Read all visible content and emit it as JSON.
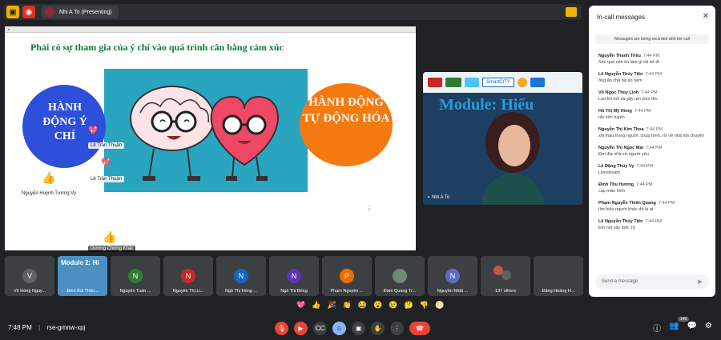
{
  "top_bar": {
    "presenter_label": "Nhi A To (Presenting)"
  },
  "slide": {
    "title": "Phải có sự tham gia của ý chí vào quá trình cân bằng cảm xúc",
    "left_circle_text": "HÀNH ĐỘNG Ý CHÍ",
    "right_circle_text": "HÀNH ĐỘNG TỰ ĐỘNG HÓA",
    "labels": {
      "le_tran_thuan_1": "Lê Trần Thuận",
      "le_tran_thuan_2": "Lê Trần Thuận",
      "nguyen_huynh_tuong_vy": "Nguyễn Huỳnh Tường Vy",
      "duong_chung_khai": "Dương Chừng Khải"
    }
  },
  "presenter_video": {
    "title_text": "Module: Hiểu",
    "name": "Nhi A To",
    "logos": [
      "SmartCITY"
    ]
  },
  "participants": [
    {
      "initial": "V",
      "name": "Võ Hồng Nguy...",
      "color": "#5f6368"
    },
    {
      "initial": "",
      "name": "Đinh Bùi Thảo...",
      "color": "#4a90c2"
    },
    {
      "initial": "N",
      "name": "Nguyễn Tuấn ...",
      "color": "#2e7d32"
    },
    {
      "initial": "N",
      "name": "Nguyễn Thị Li...",
      "color": "#c62828"
    },
    {
      "initial": "N",
      "name": "Ngô Thị Hồng ...",
      "color": "#1565c0"
    },
    {
      "initial": "N",
      "name": "Ngô Thị Bông",
      "color": "#5e35b1"
    },
    {
      "initial": "P",
      "name": "Phạm Nguyễn ...",
      "color": "#ef6c00"
    },
    {
      "initial": "",
      "name": "Đàm Quang Tr...",
      "color": "#6d8b74"
    },
    {
      "initial": "N",
      "name": "Nguyễn Nhật ...",
      "color": "#5c6bc0"
    },
    {
      "initial": "",
      "name": "137 others",
      "color": "#c05a3a"
    },
    {
      "initial": "",
      "name": "Đặng Hoàng H...",
      "color": "#3c4043"
    }
  ],
  "reactions": [
    "💖",
    "👍",
    "🎉",
    "👏",
    "😂",
    "😮",
    "😢",
    "🤔",
    "👎",
    "🌕"
  ],
  "bottom": {
    "time": "7:48 PM",
    "meeting_code": "rse-gmnw-xpj",
    "participants_count": "149"
  },
  "chat": {
    "title": "In-call messages",
    "recording_note": "Messages are being recorded with the call",
    "input_placeholder": "Send a message",
    "messages": [
      {
        "sender": "Nguyễn Thanh Triều",
        "time": "7:44 PM",
        "text": "Sốc quá nên ko làm gì rồi bỏ đi"
      },
      {
        "sender": "Lê Nguyễn Thủy Tiên",
        "time": "7:44 PM",
        "text": "ông ăn chả bà ăn nem"
      },
      {
        "sender": "Võ Ngọc Thùy Linh",
        "time": "7:44 PM",
        "text": "Lao tới hỏi và gây um xùm lên"
      },
      {
        "sender": "Hồ Thị Mỹ Hồng",
        "time": "7:44 PM",
        "text": "rắc kim tuyến"
      },
      {
        "sender": "Nguyễn Thị Kim Thoa",
        "time": "7:44 PM",
        "text": "sôi máu trong người, chụp hình, rồi về nhà nói chuyện"
      },
      {
        "sender": "Nguyễn Thị Ngọc Mai",
        "time": "7:44 PM",
        "text": "Đợi địa nhà xử người yêu"
      },
      {
        "sender": "Lê Đặng Thúy Vy",
        "time": "7:44 PM",
        "text": "Livestream"
      },
      {
        "sender": "Đinh Thu Hương",
        "time": "7:44 PM",
        "text": "cap màn hình"
      },
      {
        "sender": "Phạm Nguyễn Thiên Quang",
        "time": "7:44 PM",
        "text": "tìm hiểu người khác đó là ai"
      },
      {
        "sender": "Lê Nguyễn Thủy Tiên",
        "time": "7:44 PM",
        "text": "Em nói vậy thôi :)))"
      }
    ]
  }
}
